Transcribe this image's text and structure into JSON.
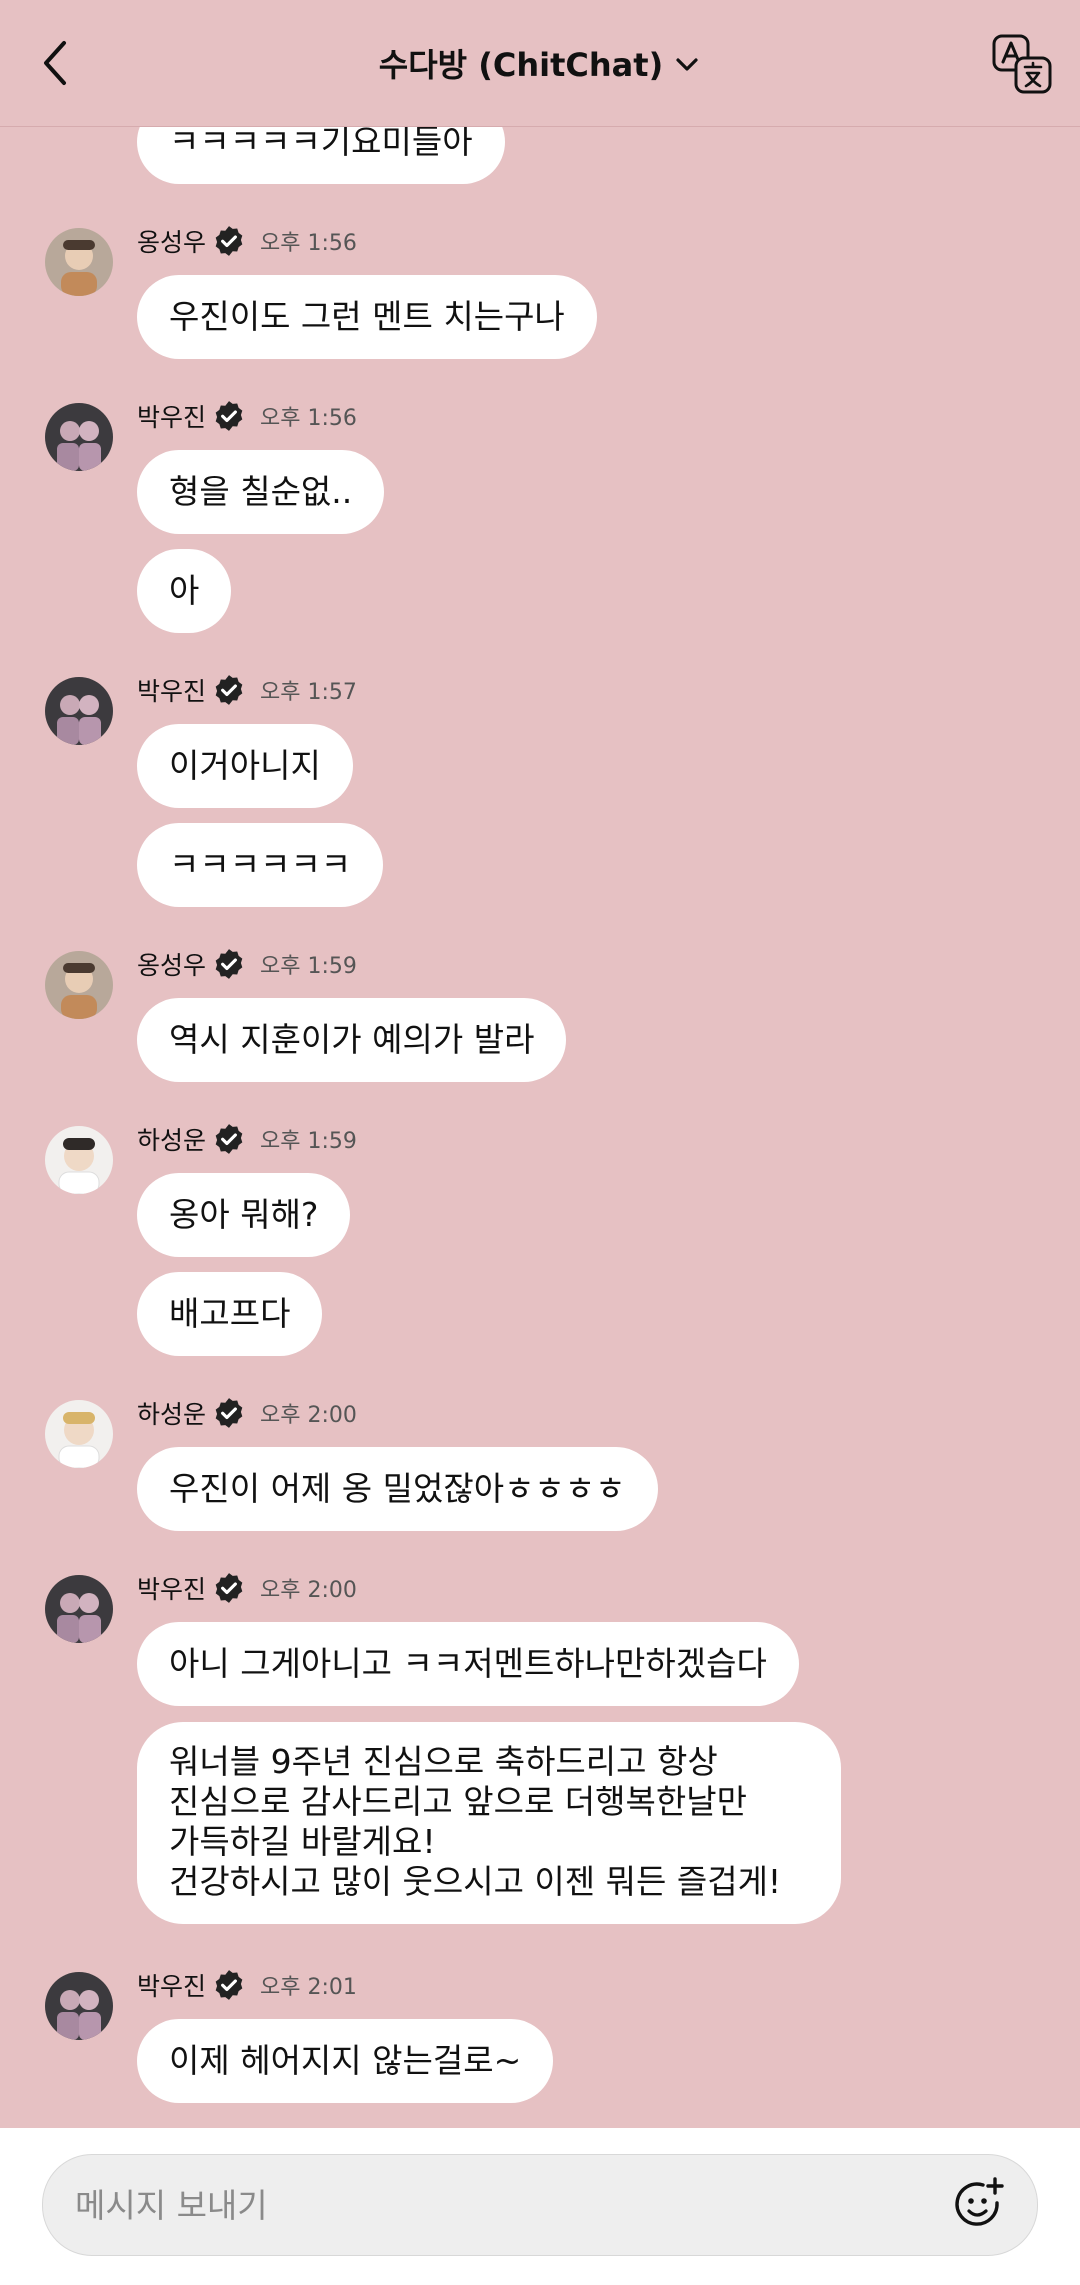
{
  "header": {
    "title": "수다방 (ChitChat)"
  },
  "composer": {
    "placeholder": "메시지 보내기"
  },
  "messages": [
    {
      "text": "ㅋㅋㅋㅋㅋ기요미들아"
    },
    {
      "sender": "옹성우",
      "time": "오후 1:56",
      "bubbles": [
        "우진이도 그런 멘트 치는구나"
      ]
    },
    {
      "sender": "박우진",
      "time": "오후 1:56",
      "bubbles": [
        "형을 칠순없..",
        "아"
      ]
    },
    {
      "sender": "박우진",
      "time": "오후 1:57",
      "bubbles": [
        "이거아니지",
        "ㅋㅋㅋㅋㅋㅋ"
      ]
    },
    {
      "sender": "옹성우",
      "time": "오후 1:59",
      "bubbles": [
        "역시 지훈이가 예의가 발라"
      ]
    },
    {
      "sender": "하성운",
      "time": "오후 1:59",
      "bubbles": [
        "옹아 뭐해?",
        "배고프다"
      ]
    },
    {
      "sender": "하성운",
      "time": "오후 2:00",
      "bubbles": [
        "우진이 어제 옹 밀었잖아ㅎㅎㅎㅎ"
      ]
    },
    {
      "sender": "박우진",
      "time": "오후 2:00",
      "bubbles": [
        "아니 그게아니고 ㅋㅋ저멘트하나만하겠습다",
        "워너블 9주년 진심으로 축하드리고 항상\n진심으로 감사드리고 앞으로 더행복한날만\n가득하길 바랄게요!\n건강하시고 많이 웃으시고 이젠 뭐든 즐겁게!"
      ]
    },
    {
      "sender": "박우진",
      "time": "오후 2:01",
      "bubbles": [
        "이제 헤어지지 않는걸로~"
      ]
    }
  ]
}
